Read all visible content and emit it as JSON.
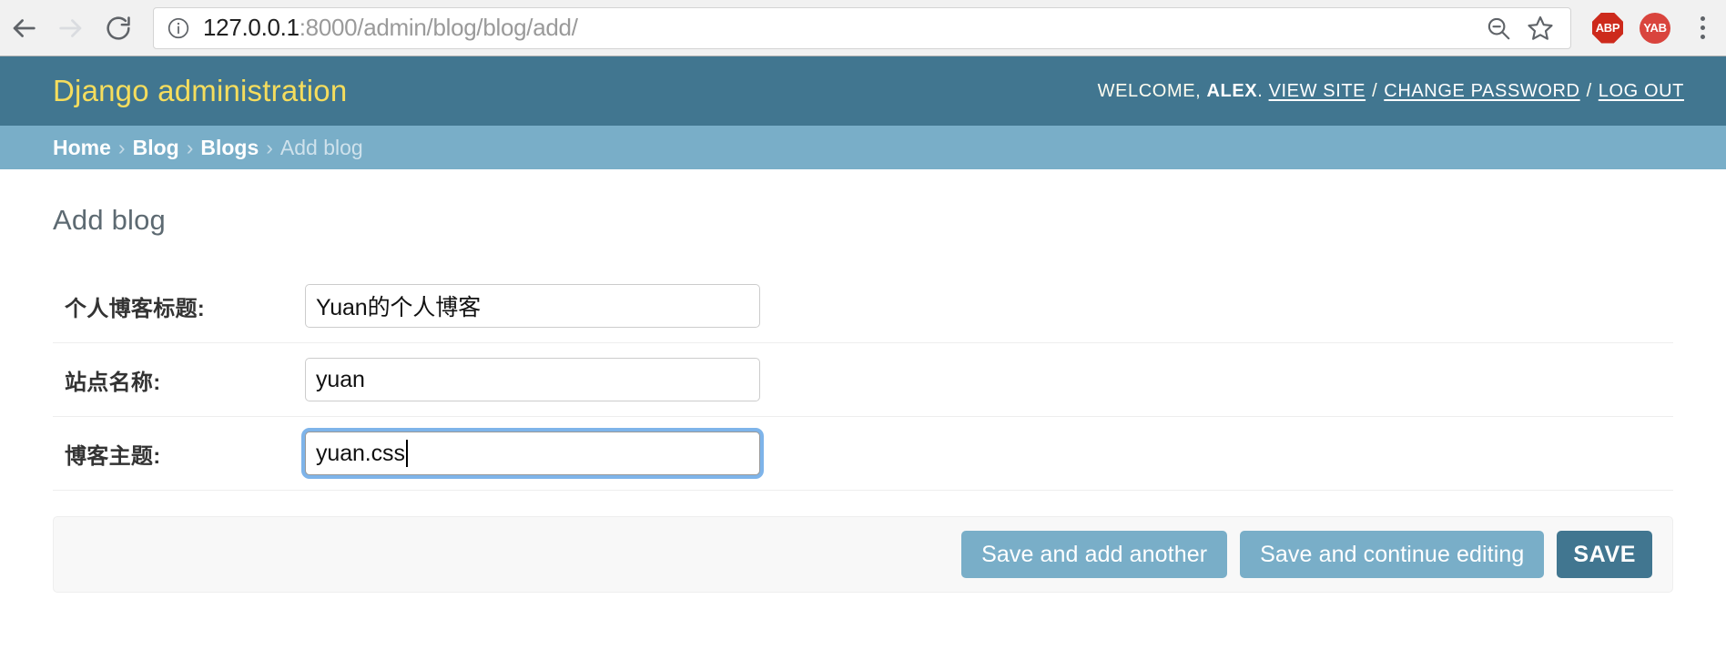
{
  "browser": {
    "nav": {
      "back_label": "Back",
      "forward_label": "Forward",
      "reload_label": "Reload"
    },
    "url": {
      "host": "127.0.0.1",
      "path": ":8000/admin/blog/blog/add/",
      "info_tooltip": "View site information"
    },
    "omnibox_icons": {
      "zoom_out_label": "Zoom out",
      "bookmark_label": "Bookmark this page"
    },
    "extensions": [
      {
        "id": "abp",
        "label": "ABP",
        "color": "#cd2a1c"
      },
      {
        "id": "yab",
        "label": "YAB",
        "color": "#d9443d"
      }
    ],
    "menu_label": "Customize and control Google Chrome"
  },
  "header": {
    "branding": "Django administration",
    "welcome_prefix": "WELCOME,",
    "username": "ALEX",
    "username_suffix": ".",
    "links": [
      {
        "label": "VIEW SITE"
      },
      {
        "label": "CHANGE PASSWORD"
      },
      {
        "label": "LOG OUT"
      }
    ],
    "link_separator": "/",
    "bg_color": "#417690",
    "branding_color": "#f5dd5d"
  },
  "breadcrumbs": {
    "items": [
      {
        "label": "Home",
        "current": false
      },
      {
        "label": "Blog",
        "current": false
      },
      {
        "label": "Blogs",
        "current": false
      },
      {
        "label": "Add blog",
        "current": true
      }
    ],
    "separator": "›",
    "bg_color": "#79aec8"
  },
  "main": {
    "page_title": "Add blog",
    "fields": [
      {
        "label": "个人博客标题:",
        "value": "Yuan的个人博客",
        "focused": false
      },
      {
        "label": "站点名称:",
        "value": "yuan",
        "focused": false
      },
      {
        "label": "博客主题:",
        "value": "yuan.css",
        "focused": true
      }
    ]
  },
  "submit_row": {
    "save_and_add_another": "Save and add another",
    "save_and_continue": "Save and continue editing",
    "save": "SAVE",
    "secondary_color": "#79aec8",
    "primary_color": "#417690"
  }
}
